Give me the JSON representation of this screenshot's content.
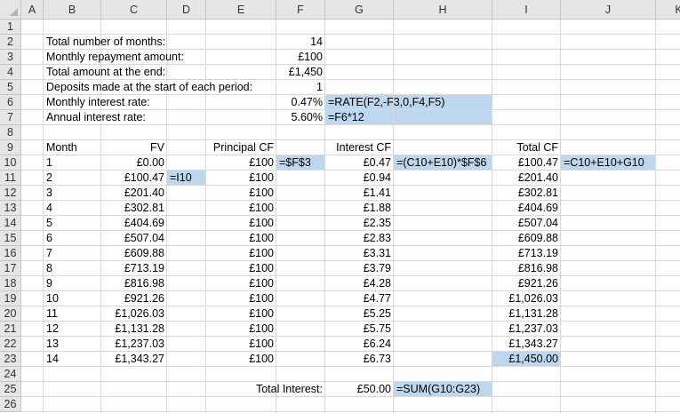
{
  "columns": [
    "A",
    "B",
    "C",
    "D",
    "E",
    "F",
    "G",
    "H",
    "I",
    "J",
    "K"
  ],
  "row_numbers": [
    "1",
    "2",
    "3",
    "4",
    "5",
    "6",
    "7",
    "8",
    "9",
    "10",
    "11",
    "12",
    "13",
    "14",
    "15",
    "16",
    "17",
    "18",
    "19",
    "20",
    "21",
    "22",
    "23",
    "24",
    "25",
    "26"
  ],
  "highlight_color": "#bdd7ee",
  "cells": {
    "r2": {
      "B": "Total number of months:",
      "F": "14"
    },
    "r3": {
      "B": "Monthly repayment amount:",
      "F": "£100"
    },
    "r4": {
      "B": "Total amount at the end:",
      "F": "£1,450"
    },
    "r5": {
      "B": "Deposits made at the start of each period:",
      "F": "1"
    },
    "r6": {
      "B": "Monthly interest rate:",
      "F": "0.47%",
      "G": "=RATE(F2,-F3,0,F4,F5)"
    },
    "r7": {
      "B": "Annual interest rate:",
      "F": "5.60%",
      "G": "=F6*12"
    },
    "r9": {
      "B": "Month",
      "C": "FV",
      "E": "Principal CF",
      "G": "Interest CF",
      "I": "Total CF"
    },
    "r10": {
      "B": "1",
      "C": "£0.00",
      "E": "£100",
      "F": "=$F$3",
      "G": "£0.47",
      "H": "=(C10+E10)*$F$6",
      "I": "£100.47",
      "J": "=C10+E10+G10"
    },
    "r11": {
      "B": "2",
      "C": "£100.47",
      "D": "=I10",
      "E": "£100",
      "G": "£0.94",
      "I": "£201.40"
    },
    "r12": {
      "B": "3",
      "C": "£201.40",
      "E": "£100",
      "G": "£1.41",
      "I": "£302.81"
    },
    "r13": {
      "B": "4",
      "C": "£302.81",
      "E": "£100",
      "G": "£1.88",
      "I": "£404.69"
    },
    "r14": {
      "B": "5",
      "C": "£404.69",
      "E": "£100",
      "G": "£2.35",
      "I": "£507.04"
    },
    "r15": {
      "B": "6",
      "C": "£507.04",
      "E": "£100",
      "G": "£2.83",
      "I": "£609.88"
    },
    "r16": {
      "B": "7",
      "C": "£609.88",
      "E": "£100",
      "G": "£3.31",
      "I": "£713.19"
    },
    "r17": {
      "B": "8",
      "C": "£713.19",
      "E": "£100",
      "G": "£3.79",
      "I": "£816.98"
    },
    "r18": {
      "B": "9",
      "C": "£816.98",
      "E": "£100",
      "G": "£4.28",
      "I": "£921.26"
    },
    "r19": {
      "B": "10",
      "C": "£921.26",
      "E": "£100",
      "G": "£4.77",
      "I": "£1,026.03"
    },
    "r20": {
      "B": "11",
      "C": "£1,026.03",
      "E": "£100",
      "G": "£5.25",
      "I": "£1,131.28"
    },
    "r21": {
      "B": "12",
      "C": "£1,131.28",
      "E": "£100",
      "G": "£5.75",
      "I": "£1,237.03"
    },
    "r22": {
      "B": "13",
      "C": "£1,237.03",
      "E": "£100",
      "G": "£6.24",
      "I": "£1,343.27"
    },
    "r23": {
      "B": "14",
      "C": "£1,343.27",
      "E": "£100",
      "G": "£6.73",
      "I": "£1,450.00"
    },
    "r25": {
      "F": "Total Interest:",
      "G": "£50.00",
      "H": "=SUM(G10:G23)"
    }
  }
}
